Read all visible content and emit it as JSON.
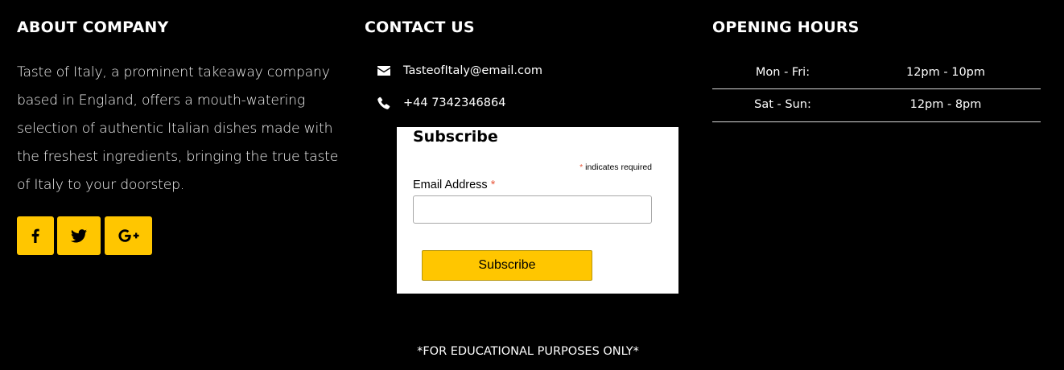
{
  "about": {
    "title": "ABOUT COMPANY",
    "text": "Taste of Italy, a prominent takeaway company based in England, offers a mouth-watering selection of authentic Italian dishes made with the freshest ingredients, bringing the true taste of Italy to your doorstep.",
    "social": [
      {
        "icon": "facebook-icon"
      },
      {
        "icon": "twitter-icon"
      },
      {
        "icon": "google-plus-icon"
      }
    ]
  },
  "contact": {
    "title": "CONTACT US",
    "email": "TasteofItaly@email.com",
    "email_icon": "envelope-icon",
    "phone": "+44 7342346864",
    "phone_icon": "phone-icon"
  },
  "subscribe": {
    "title": "Subscribe",
    "required_asterisk": "*",
    "required_note": "indicates required",
    "email_label": "Email Address",
    "email_value": "",
    "button_label": "Subscribe"
  },
  "hours": {
    "title": "OPENING HOURS",
    "rows": [
      {
        "day": "Mon - Fri:",
        "time": "12pm - 10pm"
      },
      {
        "day": "Sat - Sun:",
        "time": "12pm - 8pm"
      }
    ]
  },
  "footer": {
    "note": "*FOR EDUCATIONAL PURPOSES ONLY*"
  },
  "colors": {
    "background": "#000000",
    "accent": "#ffc600",
    "text": "#ffffff",
    "required": "#e85c41"
  }
}
